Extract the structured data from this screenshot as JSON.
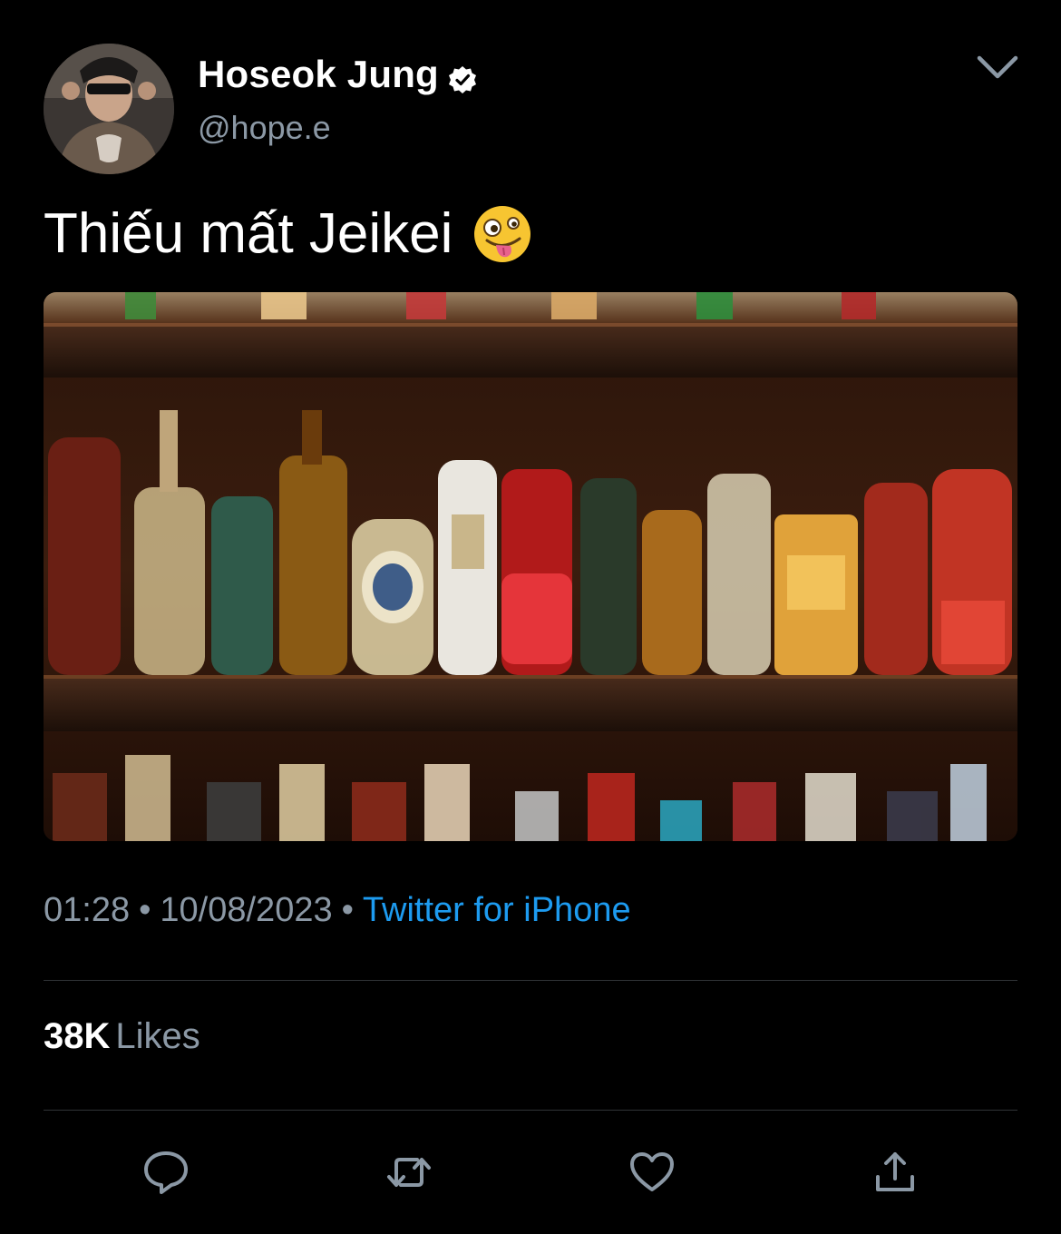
{
  "author": {
    "display_name": "Hoseok Jung",
    "handle": "@hope.e",
    "verified": true,
    "avatar_icon": "profile-photo"
  },
  "tweet": {
    "text": "Thiếu mất Jeikei",
    "emoji": "zany-face",
    "media_description_icon": "bar-shelves-photo"
  },
  "meta": {
    "time": "01:28",
    "date": "10/08/2023",
    "separator": "•",
    "source": "Twitter for iPhone"
  },
  "stats": {
    "likes_count": "38K",
    "likes_label": "Likes"
  },
  "actions": {
    "reply_icon": "reply-icon",
    "retweet_icon": "retweet-icon",
    "like_icon": "heart-icon",
    "share_icon": "share-icon"
  },
  "colors": {
    "background": "#000000",
    "secondary_text": "#8b98a5",
    "link": "#1d9bf0",
    "divider": "#2f3336"
  }
}
